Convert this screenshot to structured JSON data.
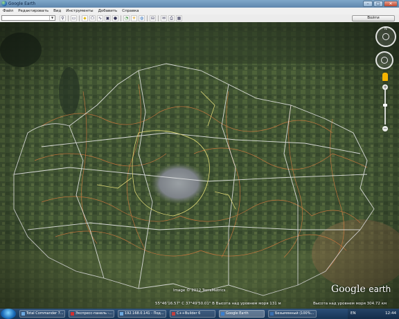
{
  "window": {
    "title": "Google Earth",
    "controls": {
      "minimize": "–",
      "maximize": "□",
      "close": "✕"
    }
  },
  "menu": {
    "items": [
      "Файл",
      "Редактировать",
      "Вид",
      "Инструменты",
      "Добавить",
      "Справка"
    ]
  },
  "toolbar": {
    "search_value": "",
    "go_label": "Войти",
    "icons": [
      "search-icon",
      "sidebar-toggle-icon",
      "placemark-icon",
      "polygon-icon",
      "path-icon",
      "overlay-icon",
      "tour-icon",
      "history-icon",
      "sun-icon",
      "planet-icon",
      "ruler-icon",
      "email-icon",
      "print-icon",
      "maps-icon"
    ]
  },
  "status": {
    "copyright": "Image © 2012 TerraMetrics",
    "coords": "55°46'16.57\" С  37°49'50.01\" В  Высота над уровнем моря   131 м",
    "eye_alt": "Высота над уровнем моря   304.72 км"
  },
  "logo": {
    "brand": "Google",
    "suffix": "earth"
  },
  "taskbar": {
    "tasks": [
      {
        "label": "Total Commander 7...",
        "active": false
      },
      {
        "label": "Экспресс-панель -...",
        "active": false
      },
      {
        "label": "192.168.0.141 - Под...",
        "active": false
      },
      {
        "label": "C++Builder 6",
        "active": false
      },
      {
        "label": "Google Earth",
        "active": true
      },
      {
        "label": "Безымянный (100%...",
        "active": false
      }
    ],
    "lang": "EN",
    "clock": "12:44"
  },
  "colors": {
    "title_bar": "#6a93bb",
    "map_dark": "#2c3b26",
    "map_green": "#4c5e38",
    "border_white": "#e8e8e8",
    "border_orange": "#d0793f",
    "border_yellow": "#e8e07a",
    "city_gray": "#8b8f93"
  }
}
